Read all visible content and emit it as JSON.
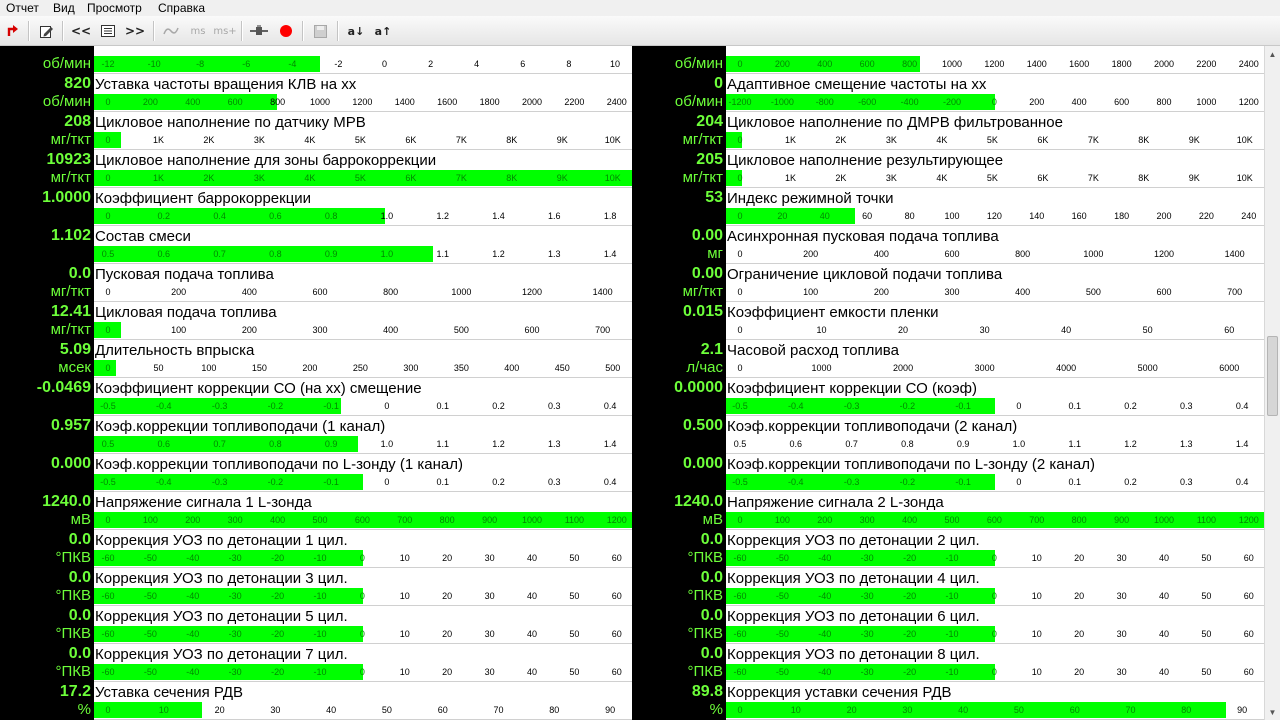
{
  "menu": [
    "Отчет",
    "Вид",
    "Просмотр",
    "Справка"
  ],
  "toolbar": {
    "icons": [
      "exit-icon",
      "edit-icon",
      "prev-icon",
      "list-icon",
      "next-icon",
      "wave-icon",
      "ms-icon",
      "ms-plus-icon",
      "plug-icon",
      "record-icon",
      "save-icon",
      "sort-down-icon",
      "sort-up-icon"
    ],
    "labels": {
      "prev": "<<",
      "next": ">>",
      "ms": "ms",
      "ms_plus": "ms+",
      "sort_down": "a↓",
      "sort_up": "a↑"
    },
    "record_color": "#ff0000"
  },
  "colors": {
    "bar": "#00ff00",
    "value": "#6dff3a",
    "label_bg": "#000000"
  },
  "scrollbar": {
    "up": "▲",
    "down": "▼"
  },
  "columns": [
    [
      {
        "value": "",
        "unit": "об/мин",
        "name": "",
        "ticks": [
          "-12",
          "-10",
          "-8",
          "-6",
          "-4",
          "-2",
          "0",
          "2",
          "4",
          "6",
          "8",
          "10"
        ],
        "fill": 0.42
      },
      {
        "value": "820",
        "unit": "об/мин",
        "name": "Уставка частоты вращения КЛВ на хх",
        "ticks": [
          "0",
          "200",
          "400",
          "600",
          "800",
          "1000",
          "1200",
          "1400",
          "1600",
          "1800",
          "2000",
          "2200",
          "2400"
        ],
        "fill": 0.34
      },
      {
        "value": "208",
        "unit": "мг/ткт",
        "name": "Цикловое наполнение по датчику МРВ",
        "ticks": [
          "0",
          "1K",
          "2K",
          "3K",
          "4K",
          "5K",
          "6K",
          "7K",
          "8K",
          "9K",
          "10K"
        ],
        "fill": 0.05
      },
      {
        "value": "10923",
        "unit": "мг/ткт",
        "name": "Цикловое наполнение для зоны баррокоррекции",
        "ticks": [
          "0",
          "1K",
          "2K",
          "3K",
          "4K",
          "5K",
          "6K",
          "7K",
          "8K",
          "9K",
          "10K"
        ],
        "fill": 1.0
      },
      {
        "value": "1.0000",
        "unit": "",
        "name": "Коэффициент баррокоррекции",
        "ticks": [
          "0",
          "0.2",
          "0.4",
          "0.6",
          "0.8",
          "1.0",
          "1.2",
          "1.4",
          "1.6",
          "1.8"
        ],
        "fill": 0.54
      },
      {
        "value": "1.102",
        "unit": "",
        "name": "Состав смеси",
        "ticks": [
          "0.5",
          "0.6",
          "0.7",
          "0.8",
          "0.9",
          "1.0",
          "1.1",
          "1.2",
          "1.3",
          "1.4"
        ],
        "fill": 0.63
      },
      {
        "value": "0.0",
        "unit": "мг/ткт",
        "name": "Пусковая подача топлива",
        "ticks": [
          "0",
          "200",
          "400",
          "600",
          "800",
          "1000",
          "1200",
          "1400"
        ],
        "fill": 0.0
      },
      {
        "value": "12.41",
        "unit": "мг/ткт",
        "name": "Цикловая подача топлива",
        "ticks": [
          "0",
          "100",
          "200",
          "300",
          "400",
          "500",
          "600",
          "700"
        ],
        "fill": 0.05
      },
      {
        "value": "5.09",
        "unit": "мсек",
        "name": "Длительность впрыска",
        "ticks": [
          "0",
          "50",
          "100",
          "150",
          "200",
          "250",
          "300",
          "350",
          "400",
          "450",
          "500"
        ],
        "fill": 0.04
      },
      {
        "value": "-0.0469",
        "unit": "",
        "name": "Коэффициент коррекции СО (на хх) смещение",
        "ticks": [
          "-0.5",
          "-0.4",
          "-0.3",
          "-0.2",
          "-0.1",
          "0",
          "0.1",
          "0.2",
          "0.3",
          "0.4"
        ],
        "fill": 0.46
      },
      {
        "value": "0.957",
        "unit": "",
        "name": "Коэф.коррекции топливоподачи (1 канал)",
        "ticks": [
          "0.5",
          "0.6",
          "0.7",
          "0.8",
          "0.9",
          "1.0",
          "1.1",
          "1.2",
          "1.3",
          "1.4"
        ],
        "fill": 0.49
      },
      {
        "value": "0.000",
        "unit": "",
        "name": "Коэф.коррекции топливоподачи по L-зонду (1 канал)",
        "ticks": [
          "-0.5",
          "-0.4",
          "-0.3",
          "-0.2",
          "-0.1",
          "0",
          "0.1",
          "0.2",
          "0.3",
          "0.4"
        ],
        "fill": 0.5
      },
      {
        "value": "1240.0",
        "unit": "мВ",
        "name": "Напряжение сигнала 1 L-зонда",
        "ticks": [
          "0",
          "100",
          "200",
          "300",
          "400",
          "500",
          "600",
          "700",
          "800",
          "900",
          "1000",
          "1100",
          "1200"
        ],
        "fill": 1.0
      },
      {
        "value": "0.0",
        "unit": "°ПКВ",
        "name": "Коррекция УОЗ по детонации 1 цил.",
        "ticks": [
          "-60",
          "-50",
          "-40",
          "-30",
          "-20",
          "-10",
          "0",
          "10",
          "20",
          "30",
          "40",
          "50",
          "60"
        ],
        "fill": 0.5
      },
      {
        "value": "0.0",
        "unit": "°ПКВ",
        "name": "Коррекция УОЗ по детонации 3 цил.",
        "ticks": [
          "-60",
          "-50",
          "-40",
          "-30",
          "-20",
          "-10",
          "0",
          "10",
          "20",
          "30",
          "40",
          "50",
          "60"
        ],
        "fill": 0.5
      },
      {
        "value": "0.0",
        "unit": "°ПКВ",
        "name": "Коррекция УОЗ по детонации 5 цил.",
        "ticks": [
          "-60",
          "-50",
          "-40",
          "-30",
          "-20",
          "-10",
          "0",
          "10",
          "20",
          "30",
          "40",
          "50",
          "60"
        ],
        "fill": 0.5
      },
      {
        "value": "0.0",
        "unit": "°ПКВ",
        "name": "Коррекция УОЗ по детонации 7 цил.",
        "ticks": [
          "-60",
          "-50",
          "-40",
          "-30",
          "-20",
          "-10",
          "0",
          "10",
          "20",
          "30",
          "40",
          "50",
          "60"
        ],
        "fill": 0.5
      },
      {
        "value": "17.2",
        "unit": "%",
        "name": "Уставка сечения РДВ",
        "ticks": [
          "0",
          "10",
          "20",
          "30",
          "40",
          "50",
          "60",
          "70",
          "80",
          "90"
        ],
        "fill": 0.2
      }
    ],
    [
      {
        "value": "",
        "unit": "об/мин",
        "name": "",
        "ticks": [
          "0",
          "200",
          "400",
          "600",
          "800",
          "1000",
          "1200",
          "1400",
          "1600",
          "1800",
          "2000",
          "2200",
          "2400"
        ],
        "fill": 0.36
      },
      {
        "value": "0",
        "unit": "об/мин",
        "name": "Адаптивное смещение частоты на хх",
        "ticks": [
          "-1200",
          "-1000",
          "-800",
          "-600",
          "-400",
          "-200",
          "0",
          "200",
          "400",
          "600",
          "800",
          "1000",
          "1200"
        ],
        "fill": 0.5
      },
      {
        "value": "204",
        "unit": "мг/ткт",
        "name": "Цикловое наполнение по ДМРВ фильтрованное",
        "ticks": [
          "0",
          "1K",
          "2K",
          "3K",
          "4K",
          "5K",
          "6K",
          "7K",
          "8K",
          "9K",
          "10K"
        ],
        "fill": 0.03
      },
      {
        "value": "205",
        "unit": "мг/ткт",
        "name": "Цикловое наполнение результирующее",
        "ticks": [
          "0",
          "1K",
          "2K",
          "3K",
          "4K",
          "5K",
          "6K",
          "7K",
          "8K",
          "9K",
          "10K"
        ],
        "fill": 0.03
      },
      {
        "value": "53",
        "unit": "",
        "name": "Индекс режимной точки",
        "ticks": [
          "0",
          "20",
          "40",
          "60",
          "80",
          "100",
          "120",
          "140",
          "160",
          "180",
          "200",
          "220",
          "240"
        ],
        "fill": 0.24
      },
      {
        "value": "0.00",
        "unit": "мг",
        "name": "Асинхронная пусковая подача топлива",
        "ticks": [
          "0",
          "200",
          "400",
          "600",
          "800",
          "1000",
          "1200",
          "1400"
        ],
        "fill": 0.0
      },
      {
        "value": "0.00",
        "unit": "мг/ткт",
        "name": "Ограничение цикловой подачи топлива",
        "ticks": [
          "0",
          "100",
          "200",
          "300",
          "400",
          "500",
          "600",
          "700"
        ],
        "fill": 0.0
      },
      {
        "value": "0.015",
        "unit": "",
        "name": "Коэффициент емкости пленки",
        "ticks": [
          "0",
          "10",
          "20",
          "30",
          "40",
          "50",
          "60"
        ],
        "fill": 0.0
      },
      {
        "value": "2.1",
        "unit": "л/час",
        "name": "Часовой расход топлива",
        "ticks": [
          "0",
          "1000",
          "2000",
          "3000",
          "4000",
          "5000",
          "6000"
        ],
        "fill": 0.0
      },
      {
        "value": "0.0000",
        "unit": "",
        "name": "Коэффициент коррекции СО (коэф)",
        "ticks": [
          "-0.5",
          "-0.4",
          "-0.3",
          "-0.2",
          "-0.1",
          "0",
          "0.1",
          "0.2",
          "0.3",
          "0.4"
        ],
        "fill": 0.5
      },
      {
        "value": "0.500",
        "unit": "",
        "name": "Коэф.коррекции топливоподачи (2 канал)",
        "ticks": [
          "0.5",
          "0.6",
          "0.7",
          "0.8",
          "0.9",
          "1.0",
          "1.1",
          "1.2",
          "1.3",
          "1.4"
        ],
        "fill": 0.0
      },
      {
        "value": "0.000",
        "unit": "",
        "name": "Коэф.коррекции топливоподачи по L-зонду (2 канал)",
        "ticks": [
          "-0.5",
          "-0.4",
          "-0.3",
          "-0.2",
          "-0.1",
          "0",
          "0.1",
          "0.2",
          "0.3",
          "0.4"
        ],
        "fill": 0.5
      },
      {
        "value": "1240.0",
        "unit": "мВ",
        "name": "Напряжение сигнала 2 L-зонда",
        "ticks": [
          "0",
          "100",
          "200",
          "300",
          "400",
          "500",
          "600",
          "700",
          "800",
          "900",
          "1000",
          "1100",
          "1200"
        ],
        "fill": 1.0
      },
      {
        "value": "0.0",
        "unit": "°ПКВ",
        "name": "Коррекция УОЗ по детонации 2 цил.",
        "ticks": [
          "-60",
          "-50",
          "-40",
          "-30",
          "-20",
          "-10",
          "0",
          "10",
          "20",
          "30",
          "40",
          "50",
          "60"
        ],
        "fill": 0.5
      },
      {
        "value": "0.0",
        "unit": "°ПКВ",
        "name": "Коррекция УОЗ по детонации 4 цил.",
        "ticks": [
          "-60",
          "-50",
          "-40",
          "-30",
          "-20",
          "-10",
          "0",
          "10",
          "20",
          "30",
          "40",
          "50",
          "60"
        ],
        "fill": 0.5
      },
      {
        "value": "0.0",
        "unit": "°ПКВ",
        "name": "Коррекция УОЗ по детонации 6 цил.",
        "ticks": [
          "-60",
          "-50",
          "-40",
          "-30",
          "-20",
          "-10",
          "0",
          "10",
          "20",
          "30",
          "40",
          "50",
          "60"
        ],
        "fill": 0.5
      },
      {
        "value": "0.0",
        "unit": "°ПКВ",
        "name": "Коррекция УОЗ по детонации 8 цил.",
        "ticks": [
          "-60",
          "-50",
          "-40",
          "-30",
          "-20",
          "-10",
          "0",
          "10",
          "20",
          "30",
          "40",
          "50",
          "60"
        ],
        "fill": 0.5
      },
      {
        "value": "89.8",
        "unit": "%",
        "name": "Коррекция уставки сечения РДВ",
        "ticks": [
          "0",
          "10",
          "20",
          "30",
          "40",
          "50",
          "60",
          "70",
          "80",
          "90"
        ],
        "fill": 0.93
      }
    ]
  ]
}
